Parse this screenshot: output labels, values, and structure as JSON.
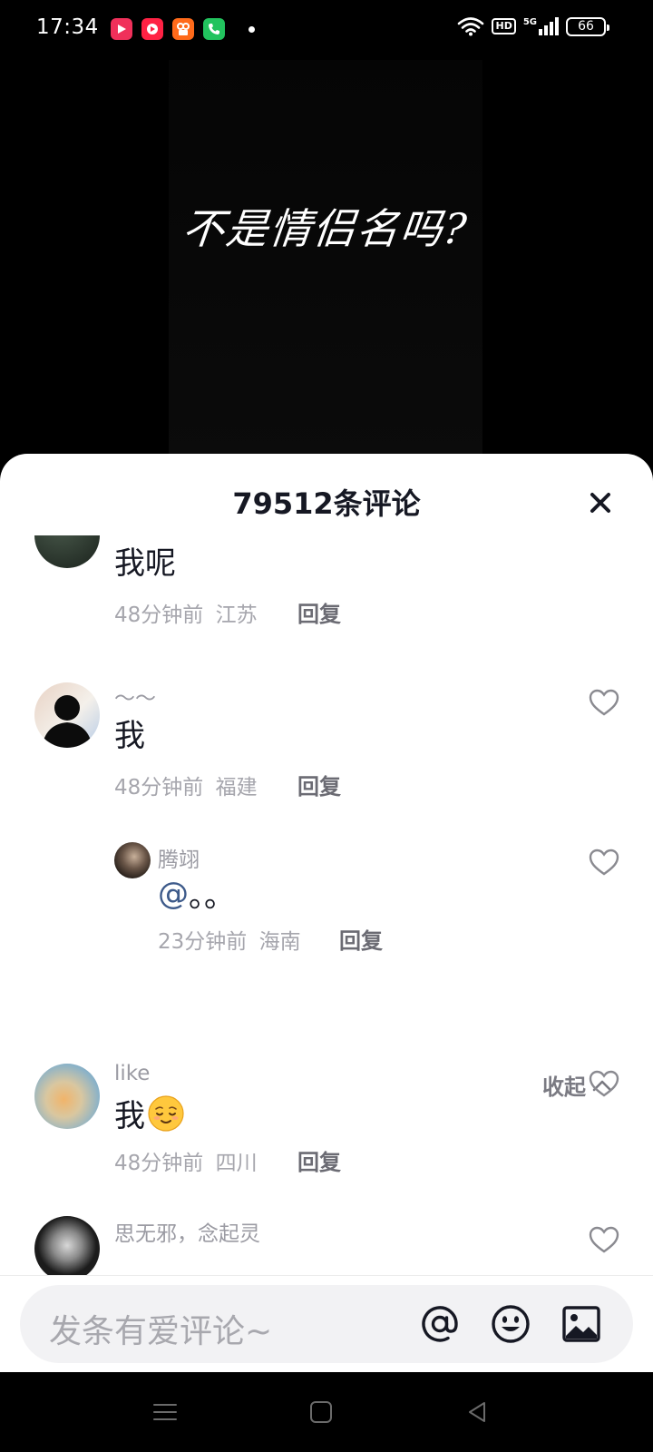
{
  "status_bar": {
    "time": "17:34",
    "app_icons": [
      "video-app-icon",
      "music-app-icon",
      "kuaishou-app-icon",
      "phone-app-icon"
    ],
    "hd": "HD",
    "network": "5G",
    "battery": "66"
  },
  "video": {
    "caption": "不是情侣名吗?"
  },
  "comments_panel": {
    "title": "79512条评论",
    "reply_label": "回复",
    "collapse_label": "收起",
    "comments": [
      {
        "username": "",
        "text": "我呢",
        "time": "48分钟前",
        "location": "江苏"
      },
      {
        "username": "～～",
        "text": "我",
        "time": "48分钟前",
        "location": "福建"
      },
      {
        "username": "like",
        "text": "我",
        "emoji": "relieved-face",
        "time": "48分钟前",
        "location": "四川"
      },
      {
        "username": "思无邪，念起灵",
        "text": "",
        "time": "",
        "location": ""
      }
    ],
    "reply": {
      "username": "腾翊",
      "mention": "@",
      "text": "。。",
      "time": "23分钟前",
      "location": "海南"
    }
  },
  "input_bar": {
    "placeholder": "发条有爱评论~",
    "icons": [
      "mention-icon",
      "emoji-icon",
      "image-icon"
    ]
  },
  "colors": {
    "sheet_bg": "#ffffff",
    "title": "#161823",
    "meta_gray": "#a6a6ad",
    "mention_blue": "#3d5a8a"
  }
}
